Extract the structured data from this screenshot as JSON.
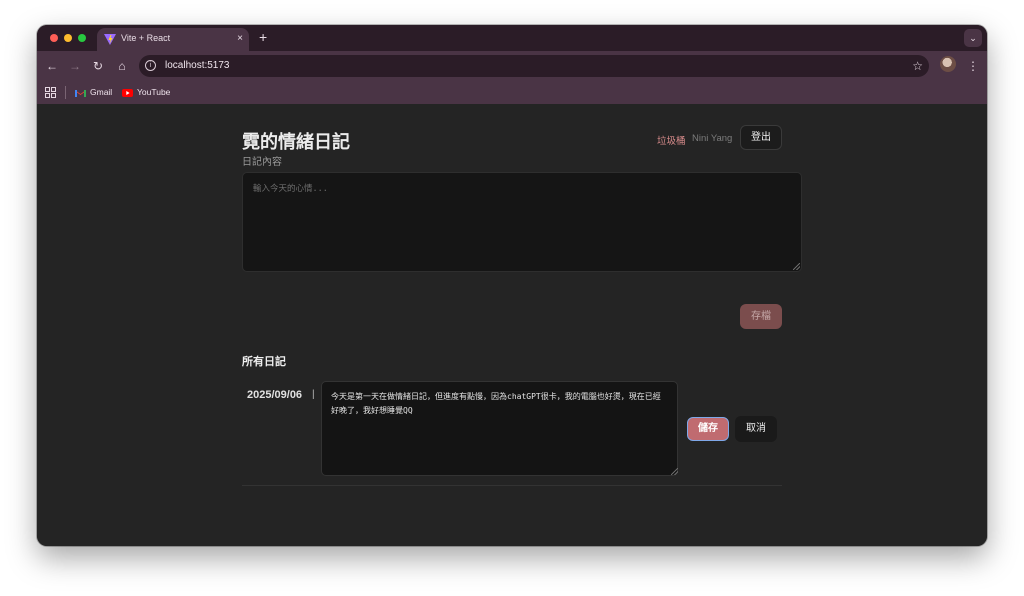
{
  "browser": {
    "tab_title": "Vite + React",
    "tab_close": "×",
    "new_tab": "+",
    "url": "localhost:5173",
    "bookmarks": [
      {
        "label": "Gmail",
        "icon": "gmail-icon"
      },
      {
        "label": "YouTube",
        "icon": "youtube-icon"
      }
    ],
    "colors": {
      "chrome": "#4a3445",
      "tabstrip": "#2b1c27"
    }
  },
  "header": {
    "title": "霓的情緒日記",
    "subtitle": "日記內容",
    "trash_label": "垃圾桶",
    "username": "Nini Yang",
    "logout_label": "登出"
  },
  "editor": {
    "placeholder": "輸入今天的心情...",
    "value": "",
    "save_label": "存檔"
  },
  "entries_section": {
    "heading": "所有日記",
    "entries": [
      {
        "date": "2025/09/06",
        "separator": "|",
        "text": "今天是第一天在做情緒日記，但進度有點慢，因為chatGPT很卡，我的電腦也好燙，現在已經好晚了，我好想睡覺QQ",
        "save_label": "儲存",
        "cancel_label": "取消"
      }
    ]
  },
  "theme": {
    "accent": "#c06b70",
    "disabled_accent": "#7b4d4d",
    "background": "#242424"
  }
}
